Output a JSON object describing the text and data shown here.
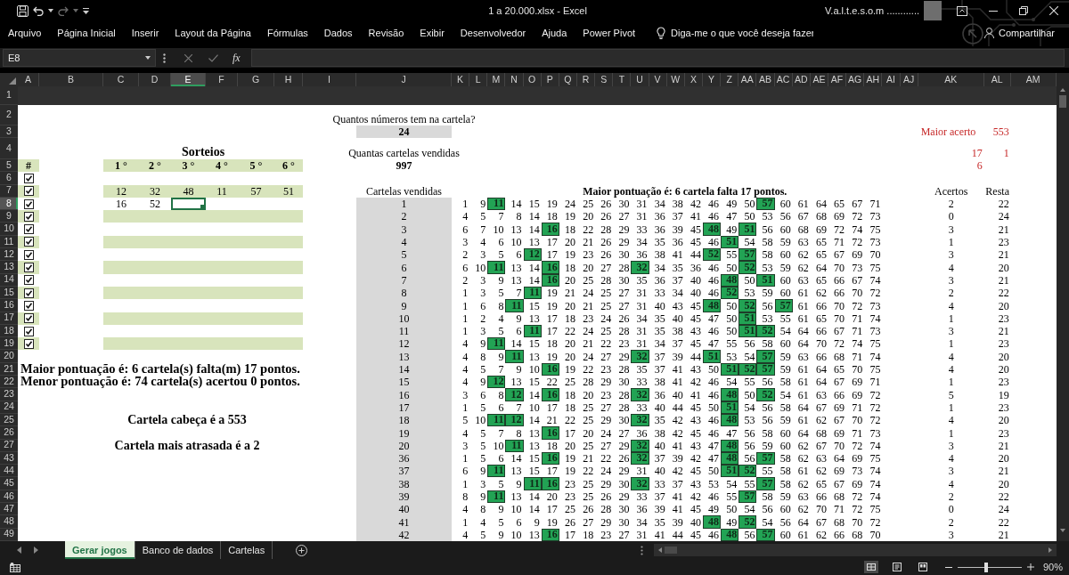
{
  "title_bar": {
    "title": "1 a 20.000.xlsx - Excel",
    "user": "V.a.l.t.e.s.o.m ............"
  },
  "ribbon_tabs": [
    "Arquivo",
    "Página Inicial",
    "Inserir",
    "Layout da Página",
    "Fórmulas",
    "Dados",
    "Revisão",
    "Exibir",
    "Desenvolvedor",
    "Ajuda",
    "Power Pivot"
  ],
  "tell_me": {
    "placeholder": "Diga-me o que você deseja fazer"
  },
  "share": {
    "label": "Compartilhar"
  },
  "formula_bar": {
    "name_box": "E8",
    "function_button": "fx"
  },
  "column_headers": [
    {
      "label": "A",
      "selected": false
    },
    {
      "label": "B",
      "selected": false
    },
    {
      "label": "C",
      "selected": false
    },
    {
      "label": "D",
      "selected": false
    },
    {
      "label": "E",
      "selected": true
    },
    {
      "label": "F",
      "selected": false
    },
    {
      "label": "G",
      "selected": false
    },
    {
      "label": "H",
      "selected": false
    },
    {
      "label": "I",
      "selected": false
    },
    {
      "label": "J",
      "selected": false
    },
    {
      "label": "K",
      "selected": false
    },
    {
      "label": "L",
      "selected": false
    },
    {
      "label": "M",
      "selected": false
    },
    {
      "label": "N",
      "selected": false
    },
    {
      "label": "O",
      "selected": false
    },
    {
      "label": "P",
      "selected": false
    },
    {
      "label": "Q",
      "selected": false
    },
    {
      "label": "R",
      "selected": false
    },
    {
      "label": "S",
      "selected": false
    },
    {
      "label": "T",
      "selected": false
    },
    {
      "label": "U",
      "selected": false
    },
    {
      "label": "V",
      "selected": false
    },
    {
      "label": "W",
      "selected": false
    },
    {
      "label": "X",
      "selected": false
    },
    {
      "label": "Y",
      "selected": false
    },
    {
      "label": "Z",
      "selected": false
    },
    {
      "label": "AA",
      "selected": false
    },
    {
      "label": "AB",
      "selected": false
    },
    {
      "label": "AC",
      "selected": false
    },
    {
      "label": "AD",
      "selected": false
    },
    {
      "label": "AE",
      "selected": false
    },
    {
      "label": "AF",
      "selected": false
    },
    {
      "label": "AG",
      "selected": false
    },
    {
      "label": "AH",
      "selected": false
    },
    {
      "label": "AI",
      "selected": false
    },
    {
      "label": "AJ",
      "selected": false
    },
    {
      "label": "AK",
      "selected": false
    },
    {
      "label": "AL",
      "selected": false
    },
    {
      "label": "AM",
      "selected": false
    }
  ],
  "row_headers": [
    {
      "label": "1",
      "selected": false
    },
    {
      "label": "2",
      "selected": false
    },
    {
      "label": "3",
      "selected": false
    },
    {
      "label": "4",
      "selected": false
    },
    {
      "label": "5",
      "selected": false
    },
    {
      "label": "6",
      "selected": false
    },
    {
      "label": "7",
      "selected": false
    },
    {
      "label": "8",
      "selected": true
    },
    {
      "label": "9",
      "selected": false
    },
    {
      "label": "10",
      "selected": false
    },
    {
      "label": "11",
      "selected": false
    },
    {
      "label": "12",
      "selected": false
    },
    {
      "label": "13",
      "selected": false
    },
    {
      "label": "14",
      "selected": false
    },
    {
      "label": "15",
      "selected": false
    },
    {
      "label": "16",
      "selected": false
    },
    {
      "label": "17",
      "selected": false
    },
    {
      "label": "18",
      "selected": false
    },
    {
      "label": "19",
      "selected": false
    },
    {
      "label": "20",
      "selected": false
    },
    {
      "label": "21",
      "selected": false
    },
    {
      "label": "22",
      "selected": false
    },
    {
      "label": "23",
      "selected": false
    },
    {
      "label": "24",
      "selected": false
    },
    {
      "label": "25",
      "selected": false
    },
    {
      "label": "26",
      "selected": false
    },
    {
      "label": "27",
      "selected": false
    },
    {
      "label": "43",
      "selected": false
    },
    {
      "label": "44",
      "selected": false
    },
    {
      "label": "45",
      "selected": false
    },
    {
      "label": "46",
      "selected": false
    },
    {
      "label": "47",
      "selected": false
    },
    {
      "label": "48",
      "selected": false
    },
    {
      "label": "49",
      "selected": false
    }
  ],
  "sheet": {
    "config": {
      "numbers_label": "Quantos números tem na cartela?",
      "numbers_value": "24",
      "sold_label": "Quantas cartelas vendidas",
      "sold_value": "997"
    },
    "stats": {
      "label": "Maior acerto",
      "value": "553",
      "pairs": [
        {
          "column_1": "17",
          "column_2": "1"
        },
        {
          "column_1": "6"
        }
      ]
    },
    "sorteios": {
      "title": "Sorteios",
      "hash": "#",
      "headers": [
        "1 °",
        "2 °",
        "3 °",
        "4 °",
        "5 °",
        "6 °"
      ],
      "rows": [
        {
          "checked": true
        },
        {
          "checked": true,
          "values": [
            "12",
            "32",
            "48",
            "11",
            "57",
            "51"
          ]
        },
        {
          "checked": true,
          "values": [
            "16",
            "52"
          ]
        },
        {
          "checked": true
        },
        {
          "checked": true
        },
        {
          "checked": true
        },
        {
          "checked": true
        },
        {
          "checked": true
        },
        {
          "checked": true
        },
        {
          "checked": true
        },
        {
          "checked": true
        },
        {
          "checked": true
        },
        {
          "checked": true
        },
        {
          "checked": true
        }
      ]
    },
    "summary": {
      "lines": [
        "Maior pontuação é: 6 cartela(s) falta(m) 17 pontos.",
        "Menor pontuação é: 74 cartela(s) acertou 0 pontos."
      ],
      "cabeca": "Cartela cabeça é a 553",
      "atrasada": "Cartela mais atrasada é a 2"
    },
    "cartelas": {
      "heading": "Cartelas vendidas",
      "title": "Maior pontuação é: 6 cartela falta 17 pontos.",
      "acertos_heading": "Acertos",
      "resta_heading": "Resta",
      "rows": [
        {
          "id": "1",
          "numbers": [
            "1",
            "9",
            "11",
            "14",
            "15",
            "19",
            "24",
            "25",
            "26",
            "30",
            "31",
            "34",
            "38",
            "42",
            "46",
            "49",
            "50",
            "57",
            "60",
            "61",
            "64",
            "65",
            "67",
            "71"
          ],
          "marked": [
            false,
            false,
            true,
            false,
            false,
            false,
            false,
            false,
            false,
            false,
            false,
            false,
            false,
            false,
            false,
            false,
            false,
            true,
            false,
            false,
            false,
            false,
            false,
            false
          ],
          "acertos": "2",
          "resta": "22"
        },
        {
          "id": "2",
          "numbers": [
            "4",
            "5",
            "7",
            "8",
            "14",
            "18",
            "19",
            "20",
            "26",
            "27",
            "31",
            "36",
            "37",
            "41",
            "46",
            "47",
            "50",
            "53",
            "56",
            "67",
            "68",
            "69",
            "72",
            "73"
          ],
          "marked": [
            false,
            false,
            false,
            false,
            false,
            false,
            false,
            false,
            false,
            false,
            false,
            false,
            false,
            false,
            false,
            false,
            false,
            false,
            false,
            false,
            false,
            false,
            false,
            false
          ],
          "acertos": "0",
          "resta": "24"
        },
        {
          "id": "3",
          "numbers": [
            "6",
            "7",
            "10",
            "13",
            "14",
            "16",
            "18",
            "22",
            "28",
            "29",
            "33",
            "36",
            "39",
            "45",
            "48",
            "49",
            "51",
            "56",
            "60",
            "68",
            "69",
            "72",
            "74",
            "75"
          ],
          "marked": [
            false,
            false,
            false,
            false,
            false,
            true,
            false,
            false,
            false,
            false,
            false,
            false,
            false,
            false,
            true,
            false,
            true,
            false,
            false,
            false,
            false,
            false,
            false,
            false
          ],
          "acertos": "3",
          "resta": "21"
        },
        {
          "id": "4",
          "numbers": [
            "3",
            "4",
            "6",
            "10",
            "13",
            "17",
            "20",
            "21",
            "26",
            "29",
            "34",
            "35",
            "36",
            "45",
            "46",
            "51",
            "54",
            "58",
            "59",
            "63",
            "65",
            "71",
            "72",
            "73"
          ],
          "marked": [
            false,
            false,
            false,
            false,
            false,
            false,
            false,
            false,
            false,
            false,
            false,
            false,
            false,
            false,
            false,
            true,
            false,
            false,
            false,
            false,
            false,
            false,
            false,
            false
          ],
          "acertos": "1",
          "resta": "23"
        },
        {
          "id": "5",
          "numbers": [
            "2",
            "3",
            "5",
            "6",
            "12",
            "17",
            "19",
            "23",
            "26",
            "30",
            "36",
            "38",
            "41",
            "44",
            "52",
            "55",
            "57",
            "58",
            "60",
            "62",
            "65",
            "67",
            "69",
            "70"
          ],
          "marked": [
            false,
            false,
            false,
            false,
            true,
            false,
            false,
            false,
            false,
            false,
            false,
            false,
            false,
            false,
            true,
            false,
            true,
            false,
            false,
            false,
            false,
            false,
            false,
            false
          ],
          "acertos": "3",
          "resta": "21"
        },
        {
          "id": "6",
          "numbers": [
            "6",
            "10",
            "11",
            "13",
            "14",
            "16",
            "18",
            "20",
            "27",
            "28",
            "32",
            "34",
            "35",
            "36",
            "46",
            "50",
            "52",
            "53",
            "59",
            "62",
            "64",
            "70",
            "73",
            "75"
          ],
          "marked": [
            false,
            false,
            true,
            false,
            false,
            true,
            false,
            false,
            false,
            false,
            true,
            false,
            false,
            false,
            false,
            false,
            true,
            false,
            false,
            false,
            false,
            false,
            false,
            false
          ],
          "acertos": "4",
          "resta": "20"
        },
        {
          "id": "7",
          "numbers": [
            "2",
            "3",
            "9",
            "13",
            "14",
            "16",
            "20",
            "25",
            "28",
            "30",
            "35",
            "36",
            "37",
            "40",
            "46",
            "48",
            "50",
            "51",
            "60",
            "63",
            "65",
            "66",
            "67",
            "74"
          ],
          "marked": [
            false,
            false,
            false,
            false,
            false,
            true,
            false,
            false,
            false,
            false,
            false,
            false,
            false,
            false,
            false,
            true,
            false,
            true,
            false,
            false,
            false,
            false,
            false,
            false
          ],
          "acertos": "3",
          "resta": "21"
        },
        {
          "id": "8",
          "numbers": [
            "1",
            "3",
            "5",
            "7",
            "11",
            "19",
            "21",
            "24",
            "25",
            "27",
            "31",
            "33",
            "34",
            "40",
            "46",
            "52",
            "53",
            "59",
            "60",
            "61",
            "62",
            "66",
            "70",
            "72"
          ],
          "marked": [
            false,
            false,
            false,
            false,
            true,
            false,
            false,
            false,
            false,
            false,
            false,
            false,
            false,
            false,
            false,
            true,
            false,
            false,
            false,
            false,
            false,
            false,
            false,
            false
          ],
          "acertos": "2",
          "resta": "22"
        },
        {
          "id": "9",
          "numbers": [
            "1",
            "6",
            "8",
            "11",
            "15",
            "19",
            "20",
            "21",
            "25",
            "27",
            "31",
            "40",
            "43",
            "45",
            "48",
            "50",
            "52",
            "56",
            "57",
            "61",
            "66",
            "70",
            "72",
            "73"
          ],
          "marked": [
            false,
            false,
            false,
            true,
            false,
            false,
            false,
            false,
            false,
            false,
            false,
            false,
            false,
            false,
            true,
            false,
            true,
            false,
            true,
            false,
            false,
            false,
            false,
            false
          ],
          "acertos": "4",
          "resta": "20"
        },
        {
          "id": "10",
          "numbers": [
            "1",
            "2",
            "4",
            "9",
            "13",
            "17",
            "18",
            "23",
            "24",
            "26",
            "34",
            "35",
            "40",
            "45",
            "47",
            "50",
            "51",
            "53",
            "55",
            "61",
            "65",
            "70",
            "71",
            "74"
          ],
          "marked": [
            false,
            false,
            false,
            false,
            false,
            false,
            false,
            false,
            false,
            false,
            false,
            false,
            false,
            false,
            false,
            false,
            true,
            false,
            false,
            false,
            false,
            false,
            false,
            false
          ],
          "acertos": "1",
          "resta": "23"
        },
        {
          "id": "11",
          "numbers": [
            "1",
            "3",
            "5",
            "6",
            "11",
            "17",
            "22",
            "24",
            "25",
            "28",
            "31",
            "35",
            "38",
            "43",
            "46",
            "50",
            "51",
            "52",
            "54",
            "64",
            "66",
            "67",
            "71",
            "73"
          ],
          "marked": [
            false,
            false,
            false,
            false,
            true,
            false,
            false,
            false,
            false,
            false,
            false,
            false,
            false,
            false,
            false,
            false,
            true,
            true,
            false,
            false,
            false,
            false,
            false,
            false
          ],
          "acertos": "3",
          "resta": "21"
        },
        {
          "id": "12",
          "numbers": [
            "4",
            "9",
            "11",
            "14",
            "15",
            "18",
            "20",
            "21",
            "22",
            "23",
            "31",
            "34",
            "37",
            "45",
            "47",
            "55",
            "56",
            "58",
            "60",
            "64",
            "70",
            "72",
            "74",
            "75"
          ],
          "marked": [
            false,
            false,
            true,
            false,
            false,
            false,
            false,
            false,
            false,
            false,
            false,
            false,
            false,
            false,
            false,
            false,
            false,
            false,
            false,
            false,
            false,
            false,
            false,
            false
          ],
          "acertos": "1",
          "resta": "23"
        },
        {
          "id": "13",
          "numbers": [
            "4",
            "8",
            "9",
            "11",
            "13",
            "19",
            "20",
            "24",
            "27",
            "29",
            "32",
            "37",
            "39",
            "44",
            "51",
            "53",
            "54",
            "57",
            "59",
            "63",
            "66",
            "68",
            "71",
            "74"
          ],
          "marked": [
            false,
            false,
            false,
            true,
            false,
            false,
            false,
            false,
            false,
            false,
            true,
            false,
            false,
            false,
            true,
            false,
            false,
            true,
            false,
            false,
            false,
            false,
            false,
            false
          ],
          "acertos": "4",
          "resta": "20"
        },
        {
          "id": "14",
          "numbers": [
            "4",
            "5",
            "7",
            "9",
            "10",
            "16",
            "19",
            "22",
            "23",
            "28",
            "35",
            "37",
            "41",
            "43",
            "50",
            "51",
            "52",
            "57",
            "59",
            "61",
            "64",
            "65",
            "70",
            "75"
          ],
          "marked": [
            false,
            false,
            false,
            false,
            false,
            true,
            false,
            false,
            false,
            false,
            false,
            false,
            false,
            false,
            false,
            true,
            true,
            true,
            false,
            false,
            false,
            false,
            false,
            false
          ],
          "acertos": "4",
          "resta": "20"
        },
        {
          "id": "15",
          "numbers": [
            "4",
            "9",
            "12",
            "13",
            "15",
            "22",
            "25",
            "28",
            "29",
            "30",
            "33",
            "38",
            "41",
            "42",
            "46",
            "54",
            "55",
            "56",
            "58",
            "61",
            "64",
            "67",
            "69",
            "71"
          ],
          "marked": [
            false,
            false,
            true,
            false,
            false,
            false,
            false,
            false,
            false,
            false,
            false,
            false,
            false,
            false,
            false,
            false,
            false,
            false,
            false,
            false,
            false,
            false,
            false,
            false
          ],
          "acertos": "1",
          "resta": "23"
        },
        {
          "id": "16",
          "numbers": [
            "3",
            "6",
            "8",
            "12",
            "14",
            "16",
            "18",
            "20",
            "23",
            "28",
            "32",
            "36",
            "40",
            "41",
            "46",
            "48",
            "50",
            "52",
            "54",
            "61",
            "63",
            "66",
            "69",
            "72"
          ],
          "marked": [
            false,
            false,
            false,
            true,
            false,
            true,
            false,
            false,
            false,
            false,
            true,
            false,
            false,
            false,
            false,
            true,
            false,
            true,
            false,
            false,
            false,
            false,
            false,
            false
          ],
          "acertos": "5",
          "resta": "19"
        },
        {
          "id": "17",
          "numbers": [
            "1",
            "5",
            "6",
            "7",
            "10",
            "17",
            "18",
            "25",
            "27",
            "28",
            "33",
            "40",
            "44",
            "45",
            "50",
            "51",
            "54",
            "56",
            "58",
            "64",
            "67",
            "69",
            "71",
            "72"
          ],
          "marked": [
            false,
            false,
            false,
            false,
            false,
            false,
            false,
            false,
            false,
            false,
            false,
            false,
            false,
            false,
            false,
            true,
            false,
            false,
            false,
            false,
            false,
            false,
            false,
            false
          ],
          "acertos": "1",
          "resta": "23"
        },
        {
          "id": "18",
          "numbers": [
            "5",
            "10",
            "11",
            "12",
            "14",
            "21",
            "22",
            "25",
            "29",
            "30",
            "32",
            "35",
            "42",
            "43",
            "46",
            "48",
            "53",
            "56",
            "59",
            "61",
            "62",
            "67",
            "70",
            "72"
          ],
          "marked": [
            false,
            false,
            true,
            true,
            false,
            false,
            false,
            false,
            false,
            false,
            true,
            false,
            false,
            false,
            false,
            true,
            false,
            false,
            false,
            false,
            false,
            false,
            false,
            false
          ],
          "acertos": "4",
          "resta": "20"
        },
        {
          "id": "19",
          "numbers": [
            "4",
            "5",
            "7",
            "8",
            "13",
            "16",
            "17",
            "20",
            "24",
            "27",
            "36",
            "38",
            "42",
            "45",
            "46",
            "47",
            "56",
            "58",
            "60",
            "64",
            "68",
            "69",
            "71",
            "73"
          ],
          "marked": [
            false,
            false,
            false,
            false,
            false,
            true,
            false,
            false,
            false,
            false,
            false,
            false,
            false,
            false,
            false,
            false,
            false,
            false,
            false,
            false,
            false,
            false,
            false,
            false
          ],
          "acertos": "1",
          "resta": "23"
        },
        {
          "id": "20",
          "numbers": [
            "3",
            "5",
            "10",
            "11",
            "13",
            "18",
            "20",
            "25",
            "27",
            "29",
            "32",
            "40",
            "41",
            "43",
            "47",
            "48",
            "56",
            "59",
            "60",
            "62",
            "67",
            "70",
            "72",
            "74"
          ],
          "marked": [
            false,
            false,
            false,
            true,
            false,
            false,
            false,
            false,
            false,
            false,
            true,
            false,
            false,
            false,
            false,
            true,
            false,
            false,
            false,
            false,
            false,
            false,
            false,
            false
          ],
          "acertos": "3",
          "resta": "21"
        },
        {
          "id": "36",
          "numbers": [
            "1",
            "5",
            "6",
            "14",
            "15",
            "16",
            "19",
            "21",
            "22",
            "26",
            "32",
            "37",
            "39",
            "42",
            "47",
            "48",
            "56",
            "57",
            "58",
            "62",
            "63",
            "64",
            "69",
            "75"
          ],
          "marked": [
            false,
            false,
            false,
            false,
            false,
            true,
            false,
            false,
            false,
            false,
            true,
            false,
            false,
            false,
            false,
            true,
            false,
            true,
            false,
            false,
            false,
            false,
            false,
            false
          ],
          "acertos": "4",
          "resta": "20"
        },
        {
          "id": "37",
          "numbers": [
            "6",
            "9",
            "11",
            "13",
            "15",
            "17",
            "19",
            "22",
            "24",
            "29",
            "31",
            "40",
            "42",
            "45",
            "50",
            "51",
            "52",
            "55",
            "58",
            "61",
            "62",
            "69",
            "73",
            "74"
          ],
          "marked": [
            false,
            false,
            true,
            false,
            false,
            false,
            false,
            false,
            false,
            false,
            false,
            false,
            false,
            false,
            false,
            true,
            true,
            false,
            false,
            false,
            false,
            false,
            false,
            false
          ],
          "acertos": "3",
          "resta": "21"
        },
        {
          "id": "38",
          "numbers": [
            "1",
            "3",
            "5",
            "9",
            "11",
            "16",
            "23",
            "25",
            "29",
            "30",
            "32",
            "33",
            "37",
            "43",
            "53",
            "54",
            "55",
            "57",
            "58",
            "62",
            "65",
            "67",
            "69",
            "74"
          ],
          "marked": [
            false,
            false,
            false,
            false,
            true,
            true,
            false,
            false,
            false,
            false,
            true,
            false,
            false,
            false,
            false,
            false,
            false,
            true,
            false,
            false,
            false,
            false,
            false,
            false
          ],
          "acertos": "4",
          "resta": "20"
        },
        {
          "id": "39",
          "numbers": [
            "8",
            "9",
            "11",
            "13",
            "14",
            "20",
            "23",
            "25",
            "26",
            "29",
            "33",
            "37",
            "41",
            "42",
            "46",
            "55",
            "57",
            "58",
            "59",
            "63",
            "66",
            "68",
            "72",
            "74"
          ],
          "marked": [
            false,
            false,
            true,
            false,
            false,
            false,
            false,
            false,
            false,
            false,
            false,
            false,
            false,
            false,
            false,
            false,
            true,
            false,
            false,
            false,
            false,
            false,
            false,
            false
          ],
          "acertos": "2",
          "resta": "22"
        },
        {
          "id": "40",
          "numbers": [
            "4",
            "8",
            "9",
            "10",
            "14",
            "17",
            "25",
            "26",
            "28",
            "30",
            "36",
            "39",
            "41",
            "45",
            "49",
            "50",
            "54",
            "56",
            "60",
            "62",
            "70",
            "71",
            "72",
            "75"
          ],
          "marked": [
            false,
            false,
            false,
            false,
            false,
            false,
            false,
            false,
            false,
            false,
            false,
            false,
            false,
            false,
            false,
            false,
            false,
            false,
            false,
            false,
            false,
            false,
            false,
            false
          ],
          "acertos": "0",
          "resta": "24"
        },
        {
          "id": "41",
          "numbers": [
            "1",
            "4",
            "5",
            "6",
            "9",
            "19",
            "26",
            "27",
            "29",
            "30",
            "34",
            "35",
            "39",
            "40",
            "48",
            "49",
            "52",
            "54",
            "56",
            "64",
            "67",
            "68",
            "70",
            "72"
          ],
          "marked": [
            false,
            false,
            false,
            false,
            false,
            false,
            false,
            false,
            false,
            false,
            false,
            false,
            false,
            false,
            true,
            false,
            true,
            false,
            false,
            false,
            false,
            false,
            false,
            false
          ],
          "acertos": "2",
          "resta": "22"
        },
        {
          "id": "42",
          "numbers": [
            "4",
            "5",
            "9",
            "10",
            "13",
            "16",
            "17",
            "18",
            "23",
            "27",
            "31",
            "41",
            "44",
            "45",
            "46",
            "48",
            "56",
            "57",
            "60",
            "61",
            "62",
            "66",
            "68",
            "70"
          ],
          "marked": [
            false,
            false,
            false,
            false,
            false,
            true,
            false,
            false,
            false,
            false,
            false,
            false,
            false,
            false,
            false,
            true,
            false,
            true,
            false,
            false,
            false,
            false,
            false,
            false
          ],
          "acertos": "3",
          "resta": "21"
        }
      ]
    }
  },
  "sheet_tabs": [
    {
      "label": "Gerar jogos",
      "selected": true
    },
    {
      "label": "Banco de dados",
      "selected": false
    },
    {
      "label": "Cartelas",
      "selected": false
    }
  ],
  "status_bar": {
    "views": [
      {
        "kind": "normal",
        "selected": true
      },
      {
        "kind": "page_layout",
        "selected": false
      },
      {
        "kind": "page_break",
        "selected": false
      }
    ],
    "zoom": {
      "level": 0.45,
      "reading": "90%"
    }
  }
}
